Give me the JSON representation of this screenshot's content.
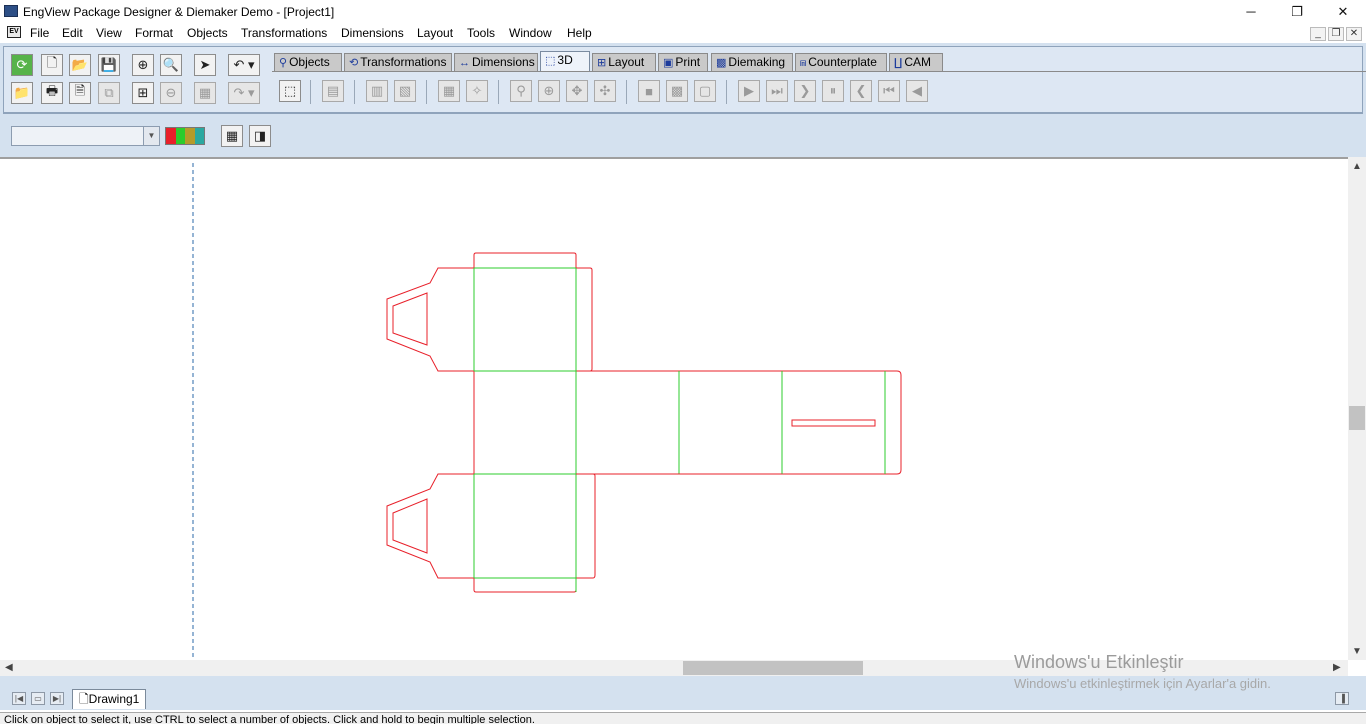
{
  "window": {
    "title": "EngView Package Designer & Diemaker Demo - [Project1]",
    "minimize_label": "─",
    "restore_label": "❐",
    "close_label": "✕"
  },
  "menubar": {
    "items": [
      "File",
      "Edit",
      "View",
      "Format",
      "Objects",
      "Transformations",
      "Dimensions",
      "Layout",
      "Tools",
      "Window",
      "Help"
    ],
    "mdi_minimize": "_",
    "mdi_restore": "❐",
    "mdi_close": "✕"
  },
  "tabs": [
    {
      "label": "Objects",
      "icon": "objects-icon",
      "active": false
    },
    {
      "label": "Transformations",
      "icon": "transformations-icon",
      "active": false
    },
    {
      "label": "Dimensions",
      "icon": "dimensions-icon",
      "active": false
    },
    {
      "label": "3D",
      "icon": "cube-icon",
      "active": true
    },
    {
      "label": "Layout",
      "icon": "layout-icon",
      "active": false
    },
    {
      "label": "Print",
      "icon": "print-icon",
      "active": false
    },
    {
      "label": "Diemaking",
      "icon": "diemaking-icon",
      "active": false
    },
    {
      "label": "Counterplate",
      "icon": "counterplate-icon",
      "active": false
    },
    {
      "label": "CAM",
      "icon": "cam-icon",
      "active": false
    }
  ],
  "combo": {
    "value": ""
  },
  "colors": {
    "cut_line": "#e8202a",
    "crease_line": "#2ccc2c",
    "guide_line": "#2b6aa8",
    "toolbar_bg": "#d4e1ef"
  },
  "bottom": {
    "document_tab": "Drawing1",
    "status": "Click on object to select it, use CTRL to select a number of objects. Click and hold to begin multiple selection."
  },
  "watermark": {
    "line1": "Windows'u Etkinleştir",
    "line2": "Windows'u etkinleştirmek için Ayarlar'a gidin."
  }
}
